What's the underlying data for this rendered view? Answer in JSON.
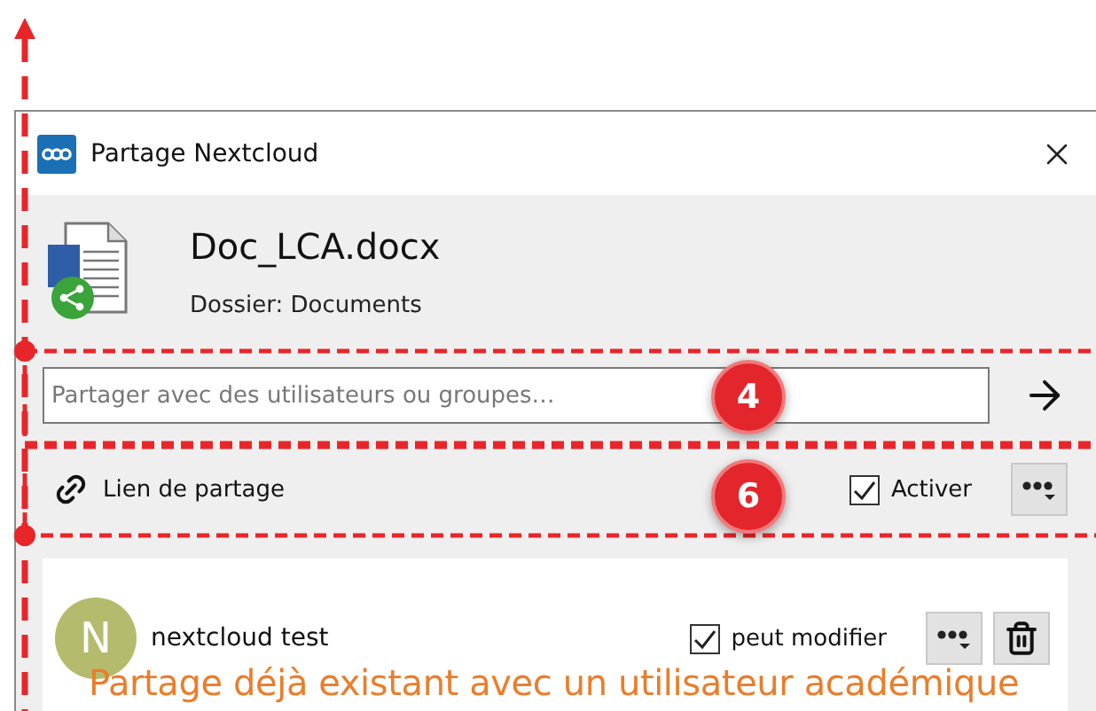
{
  "window": {
    "title": "Partage Nextcloud"
  },
  "file": {
    "name": "Doc_LCA.docx",
    "folder": "Dossier: Documents"
  },
  "share_search": {
    "placeholder": "Partager avec des utilisateurs ou groupes…"
  },
  "share_link": {
    "label": "Lien de partage",
    "enable_label": "Activer",
    "enabled": true
  },
  "shares": [
    {
      "avatar": "N",
      "name": "nextcloud test",
      "permission_label": "peut modifier",
      "can_edit": true
    }
  ],
  "annotations": {
    "badges": [
      {
        "label": "4"
      },
      {
        "label": "6"
      }
    ],
    "caption": "Partage déjà existant avec un utilisateur académique"
  }
}
